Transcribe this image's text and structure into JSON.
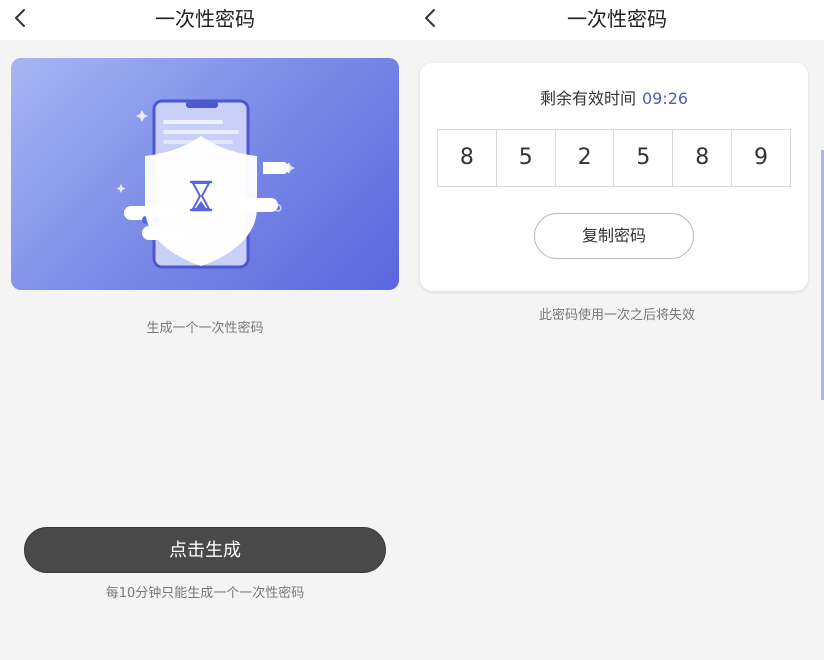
{
  "left": {
    "nav": {
      "title": "一次性密码",
      "back_icon": "chevron-left-icon"
    },
    "hero": {
      "illustration": "shield-hourglass-phone-illustration"
    },
    "hint": "生成一个一次性密码",
    "generate_button": "点击生成",
    "note": "每10分钟只能生成一个一次性密码"
  },
  "right": {
    "nav": {
      "title": "一次性密码",
      "back_icon": "chevron-left-icon"
    },
    "card": {
      "remaining_label": "剩余有效时间",
      "timer": "09:26",
      "digits": [
        "8",
        "5",
        "2",
        "5",
        "8",
        "9"
      ],
      "copy_button": "复制密码"
    },
    "note": "此密码使用一次之后将失效"
  },
  "colors": {
    "nav_bg": "#ffffff",
    "page_bg": "#f4f4f4",
    "primary_button": "#494949",
    "timer_accent": "#4d5fb5",
    "hero_gradient_start": "#a7b6f4",
    "hero_gradient_end": "#5a66dc"
  }
}
